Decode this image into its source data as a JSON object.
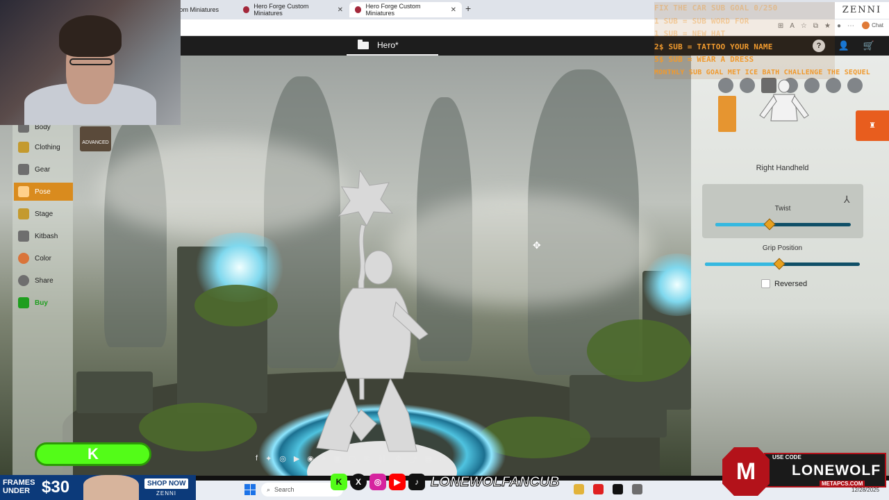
{
  "browser": {
    "tabs": [
      {
        "title": "tom Miniatures"
      },
      {
        "title": "Hero Forge Custom Miniatures"
      },
      {
        "title": "Hero Forge Custom Miniatures"
      }
    ],
    "chat_label": "Chat"
  },
  "app": {
    "file_name": "Hero*"
  },
  "left_nav": {
    "items": [
      {
        "label": "Body"
      },
      {
        "label": "Clothing"
      },
      {
        "label": "Gear"
      },
      {
        "label": "Pose",
        "active": true
      },
      {
        "label": "Stage"
      },
      {
        "label": "Kitbash"
      },
      {
        "label": "Color"
      },
      {
        "label": "Share"
      },
      {
        "label": "Buy"
      }
    ],
    "advanced_label": "ADVANCED"
  },
  "right_panel": {
    "slot_title": "Right Handheld",
    "twist": {
      "label": "Twist",
      "value": 0.4
    },
    "grip": {
      "label": "Grip Position",
      "value": 0.48
    },
    "reversed": {
      "label": "Reversed",
      "checked": false
    }
  },
  "overlay": {
    "sub_goals": [
      "FIX THE CAR SUB GOAL 0/250",
      "1 SUB = SUB WORD FOR",
      "1 SUB = NEW HAT",
      "2$ SUB = TATTOO YOUR NAME",
      "5$ SUB = WEAR A DRESS",
      "MONTHLY SUB GOAL MET ICE BATH CHALLENGE THE SEQUEL"
    ],
    "zenni_logo": "ZENNI",
    "promo": {
      "frames_label": "FRAMES UNDER",
      "price": "$30",
      "shop_now": "SHOP NOW",
      "brand": "ZENNI"
    },
    "handle": "LONEWOLFANCUB",
    "code_card": {
      "use_code": "USE CODE",
      "code": "LONEWOLF",
      "site": "METAPCS.COM"
    },
    "kick_symbol": "K"
  },
  "taskbar": {
    "search_placeholder": "Search",
    "date": "12/28/2025"
  },
  "colors": {
    "accent_orange": "#d98b1e",
    "buy_green": "#1e9e1e",
    "slider_cyan": "#35b8e0",
    "knob": "#e8a11e"
  }
}
